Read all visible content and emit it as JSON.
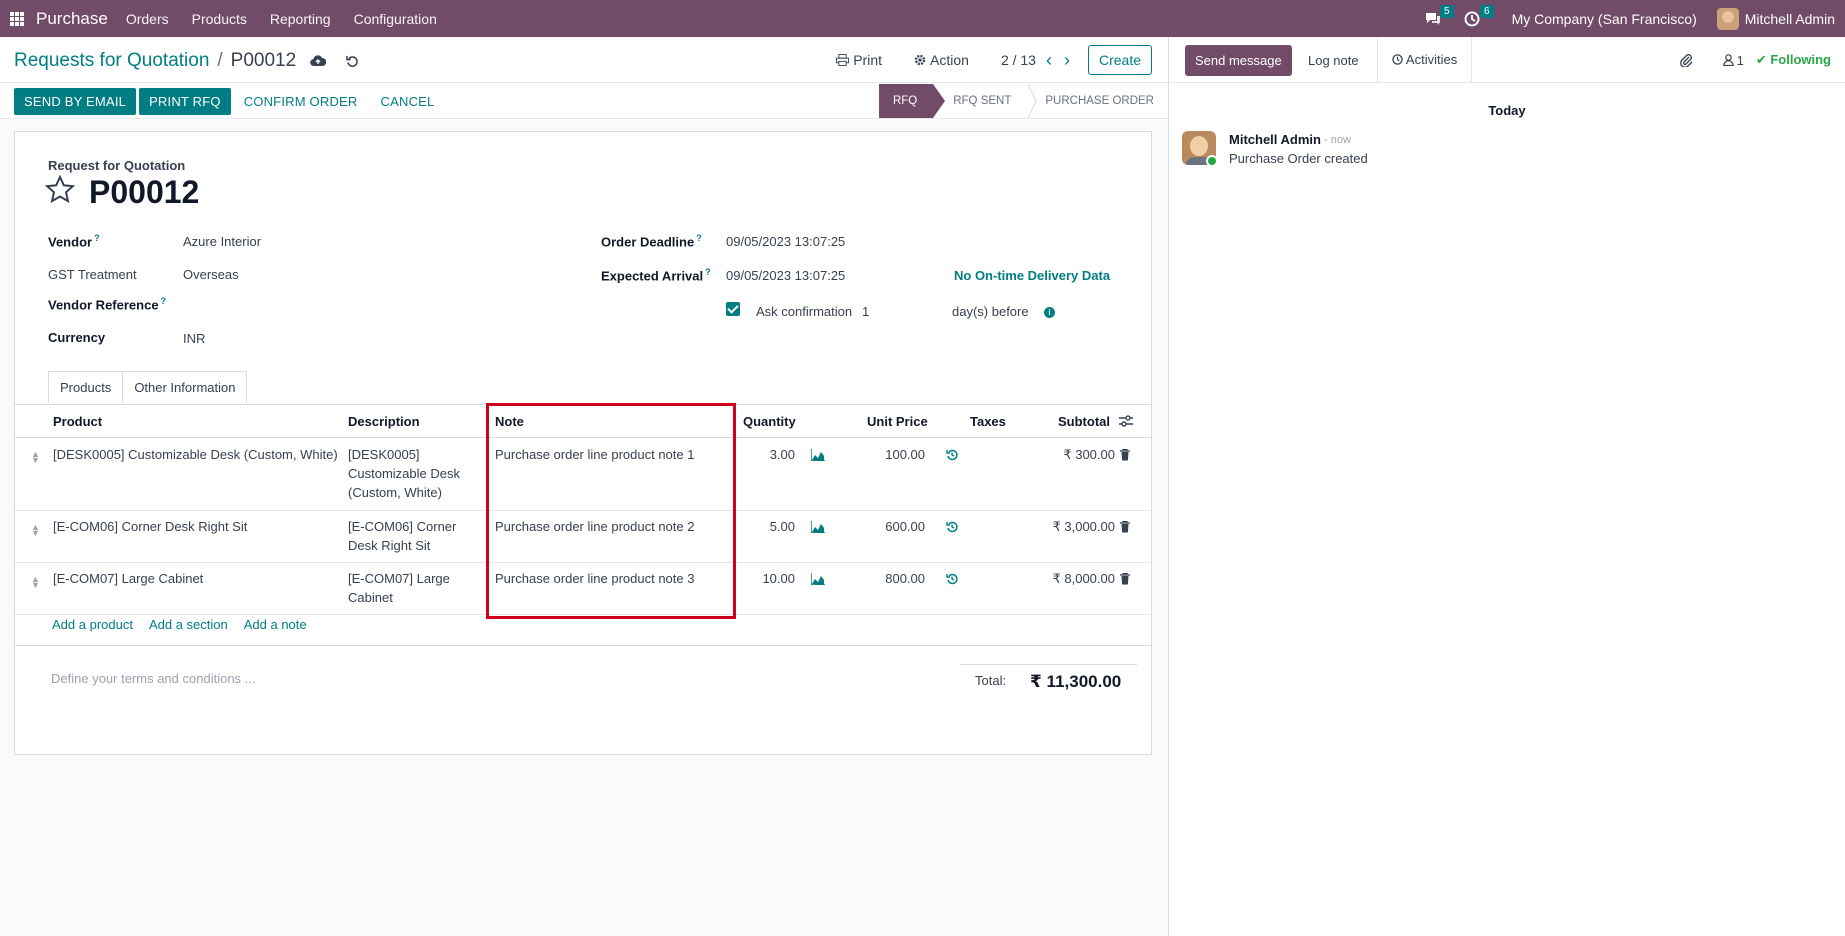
{
  "navbar": {
    "brand": "Purchase",
    "menu": [
      "Orders",
      "Products",
      "Reporting",
      "Configuration"
    ],
    "messages_count": "5",
    "activities_count": "6",
    "company": "My Company (San Francisco)",
    "user": "Mitchell Admin"
  },
  "control": {
    "breadcrumb_parent": "Requests for Quotation",
    "breadcrumb_current": "P00012",
    "print_label": "Print",
    "action_label": "Action",
    "pager": "2 / 13",
    "create_label": "Create"
  },
  "statusbar": {
    "buttons": [
      "SEND BY EMAIL",
      "PRINT RFQ",
      "CONFIRM ORDER",
      "CANCEL"
    ],
    "stages": [
      "RFQ",
      "RFQ SENT",
      "PURCHASE ORDER"
    ],
    "active_stage": "RFQ"
  },
  "form": {
    "doc_kind": "Request for Quotation",
    "name": "P00012",
    "vendor_label": "Vendor",
    "vendor": "Azure Interior",
    "gst_label": "GST Treatment",
    "gst": "Overseas",
    "vendor_ref_label": "Vendor Reference",
    "currency_label": "Currency",
    "currency": "INR",
    "deadline_label": "Order Deadline",
    "deadline": "09/05/2023 13:07:25",
    "arrival_label": "Expected Arrival",
    "arrival": "09/05/2023 13:07:25",
    "delivery_data": "No On-time Delivery Data",
    "ask_confirmation_label": "Ask confirmation",
    "ask_confirmation_days": "1",
    "days_before": "day(s) before"
  },
  "tabs": [
    "Products",
    "Other Information"
  ],
  "lines": {
    "columns": [
      "Product",
      "Description",
      "Note",
      "Quantity",
      "Unit Price",
      "Taxes",
      "Subtotal"
    ],
    "rows": [
      {
        "product": "[DESK0005] Customizable Desk (Custom, White)",
        "description": "[DESK0005] Customizable Desk (Custom, White)",
        "note": "Purchase order line product note 1",
        "quantity": "3.00",
        "unit_price": "100.00",
        "taxes": "",
        "subtotal": "₹ 300.00"
      },
      {
        "product": "[E-COM06] Corner Desk Right Sit",
        "description": "[E-COM06] Corner Desk Right Sit",
        "note": "Purchase order line product note 2",
        "quantity": "5.00",
        "unit_price": "600.00",
        "taxes": "",
        "subtotal": "₹ 3,000.00"
      },
      {
        "product": "[E-COM07] Large Cabinet",
        "description": "[E-COM07] Large Cabinet",
        "note": "Purchase order line product note 3",
        "quantity": "10.00",
        "unit_price": "800.00",
        "taxes": "",
        "subtotal": "₹ 8,000.00"
      }
    ],
    "add_product": "Add a product",
    "add_section": "Add a section",
    "add_note": "Add a note"
  },
  "footer": {
    "terms_placeholder": "Define your terms and conditions ...",
    "total_label": "Total:",
    "total_value": "₹ 11,300.00"
  },
  "chatter": {
    "send_message": "Send message",
    "log_note": "Log note",
    "activities": "Activities",
    "followers_count": "1",
    "following": "Following",
    "today": "Today",
    "message": {
      "author": "Mitchell Admin",
      "time": "- now",
      "body": "Purchase Order created"
    }
  },
  "colors": {
    "brand": "#714B67",
    "accent": "#017E84",
    "highlight": "#d0021b",
    "following": "#28a745"
  }
}
